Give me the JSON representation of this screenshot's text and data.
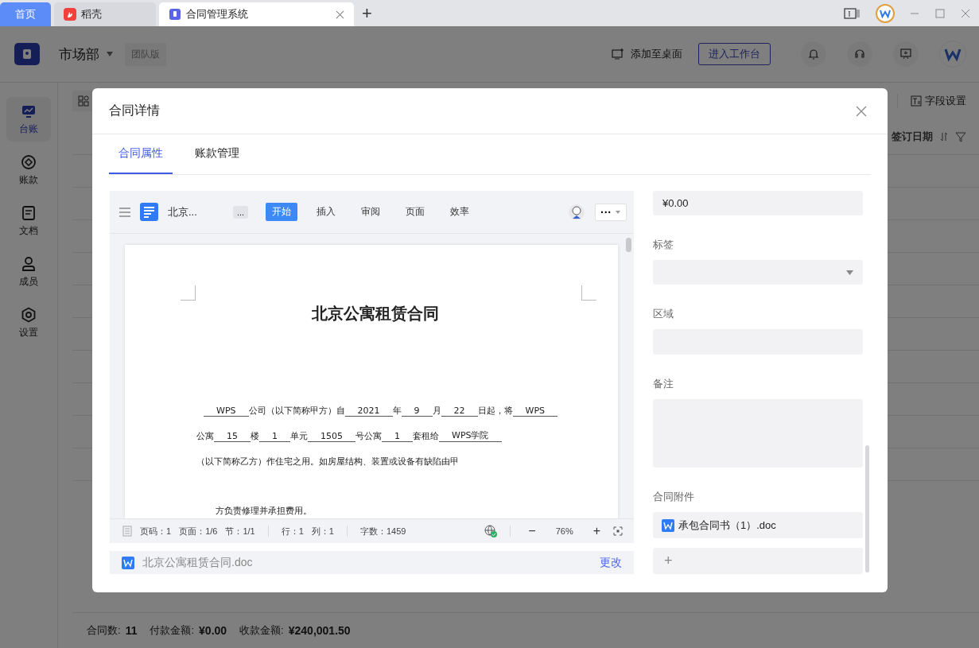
{
  "browser_tabs": [
    {
      "label": "首页",
      "kind": "home",
      "selected": false
    },
    {
      "label": "稻壳",
      "kind": "docer",
      "selected": false
    },
    {
      "label": "合同管理系统",
      "kind": "app",
      "selected": true
    }
  ],
  "new_tab": "+",
  "header": {
    "department": "市场部",
    "edition": "团队版",
    "add_to_desktop": "添加至桌面",
    "workspace_button": "进入工作台"
  },
  "sidebar": {
    "items": [
      {
        "label": "台账",
        "kind": "ledger",
        "selected": true
      },
      {
        "label": "账款",
        "kind": "payment",
        "selected": false
      },
      {
        "label": "文档",
        "kind": "document",
        "selected": false
      },
      {
        "label": "成员",
        "kind": "member",
        "selected": false
      },
      {
        "label": "设置",
        "kind": "settings",
        "selected": false
      }
    ]
  },
  "table": {
    "field_settings": "字段设置",
    "column_header": "签订日期"
  },
  "footer": [
    {
      "label": "合同数:",
      "value": "11"
    },
    {
      "label": "付款金额:",
      "value": "¥0.00"
    },
    {
      "label": "收款金额:",
      "value": "¥240,001.50"
    }
  ],
  "dialog": {
    "title": "合同详情",
    "tabs": [
      {
        "label": "合同属性",
        "selected": true
      },
      {
        "label": "账款管理",
        "selected": false
      }
    ],
    "document": {
      "toolbar": {
        "name": "北京...",
        "more": "...",
        "tabs": [
          {
            "label": "开始",
            "selected": true
          },
          {
            "label": "插入",
            "selected": false
          },
          {
            "label": "审阅",
            "selected": false
          },
          {
            "label": "页面",
            "selected": false
          },
          {
            "label": "效率",
            "selected": false
          }
        ],
        "menu": "···"
      },
      "title": "北京公寓租赁合同",
      "lines": [
        {
          "indent": true,
          "spaced": false,
          "segments": [
            {
              "t": "WPS",
              "u": true
            },
            {
              "t": "公司（以下简称甲方）自",
              "u": false
            },
            {
              "t": "2021",
              "u": true
            },
            {
              "t": "年",
              "u": false
            },
            {
              "t": "9",
              "u": true
            },
            {
              "t": "月",
              "u": false
            },
            {
              "t": "22",
              "u": true
            },
            {
              "t": "日起，将",
              "u": false
            },
            {
              "t": "WPS",
              "u": true
            }
          ]
        },
        {
          "indent": false,
          "spaced": false,
          "segments": [
            {
              "t": "公寓",
              "u": false
            },
            {
              "t": "15",
              "u": true
            },
            {
              "t": "楼",
              "u": false
            },
            {
              "t": "1",
              "u": true
            },
            {
              "t": "单元",
              "u": false
            },
            {
              "t": "1505",
              "u": true
            },
            {
              "t": "号公寓",
              "u": false
            },
            {
              "t": "1",
              "u": true
            },
            {
              "t": "套租给",
              "u": false
            },
            {
              "t": "WPS学院",
              "u": true
            }
          ]
        },
        {
          "indent": false,
          "spaced": false,
          "segments": [
            {
              "t": "（以下简称乙方）作住宅之用。如房屋结构、装置或设备有缺陷由甲",
              "u": false
            }
          ]
        },
        {
          "indent": true,
          "spaced": true,
          "segments": [
            {
              "t": "方负责修理并承担费用。",
              "u": false
            }
          ]
        }
      ],
      "status": {
        "groups": [
          [
            "页码：1",
            "页面：1/6",
            "节：1/1"
          ],
          [
            "行：1",
            "列：1"
          ],
          [
            "字数：1459"
          ]
        ],
        "zoom_out": "−",
        "zoom": "76%",
        "zoom_in": "+"
      },
      "file": {
        "name": "北京公寓租赁合同.doc",
        "action": "更改"
      }
    },
    "fields": [
      {
        "kind": "input",
        "value": "¥0.00"
      },
      {
        "kind": "select",
        "label": "标签"
      },
      {
        "kind": "input",
        "label": "区域"
      },
      {
        "kind": "textarea",
        "label": "备注"
      },
      {
        "kind": "attachments",
        "label": "合同附件",
        "files": [
          "承包合同书（1）.doc"
        ],
        "add": "+"
      }
    ]
  }
}
